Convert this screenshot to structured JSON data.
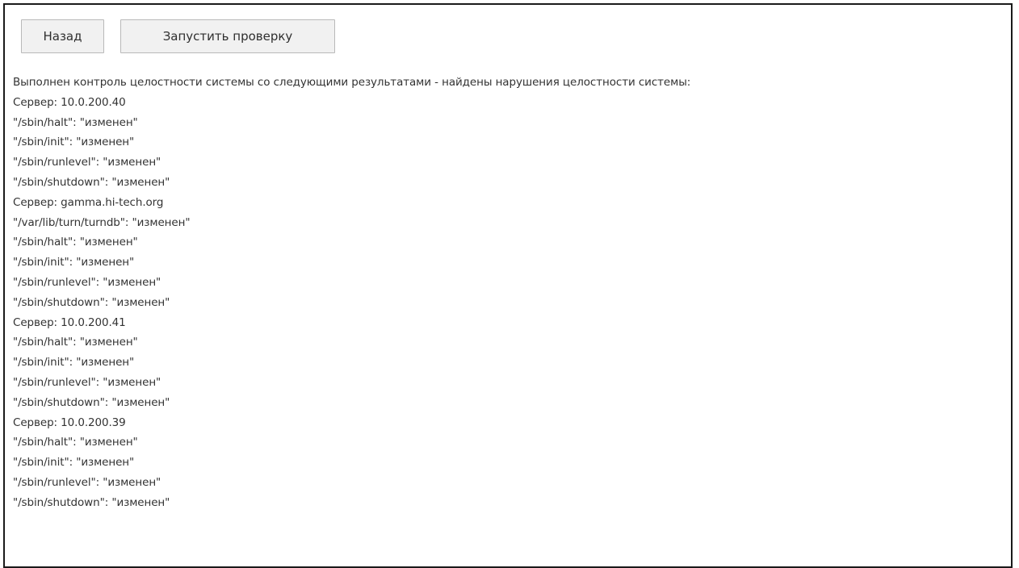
{
  "toolbar": {
    "back_label": "Назад",
    "run_check_label": "Запустить проверку"
  },
  "result": {
    "summary": "Выполнен контроль целостности системы со следующими результатами - найдены нарушения целостности системы:",
    "lines": [
      "Сервер: 10.0.200.40",
      "\"/sbin/halt\": \"изменен\"",
      "\"/sbin/init\": \"изменен\"",
      "\"/sbin/runlevel\": \"изменен\"",
      "\"/sbin/shutdown\": \"изменен\"",
      "Сервер: gamma.hi-tech.org",
      "\"/var/lib/turn/turndb\": \"изменен\"",
      "\"/sbin/halt\": \"изменен\"",
      "\"/sbin/init\": \"изменен\"",
      "\"/sbin/runlevel\": \"изменен\"",
      "\"/sbin/shutdown\": \"изменен\"",
      "Сервер: 10.0.200.41",
      "\"/sbin/halt\": \"изменен\"",
      "\"/sbin/init\": \"изменен\"",
      "\"/sbin/runlevel\": \"изменен\"",
      "\"/sbin/shutdown\": \"изменен\"",
      "Сервер: 10.0.200.39",
      "\"/sbin/halt\": \"изменен\"",
      "\"/sbin/init\": \"изменен\"",
      "\"/sbin/runlevel\": \"изменен\"",
      "\"/sbin/shutdown\": \"изменен\""
    ]
  }
}
